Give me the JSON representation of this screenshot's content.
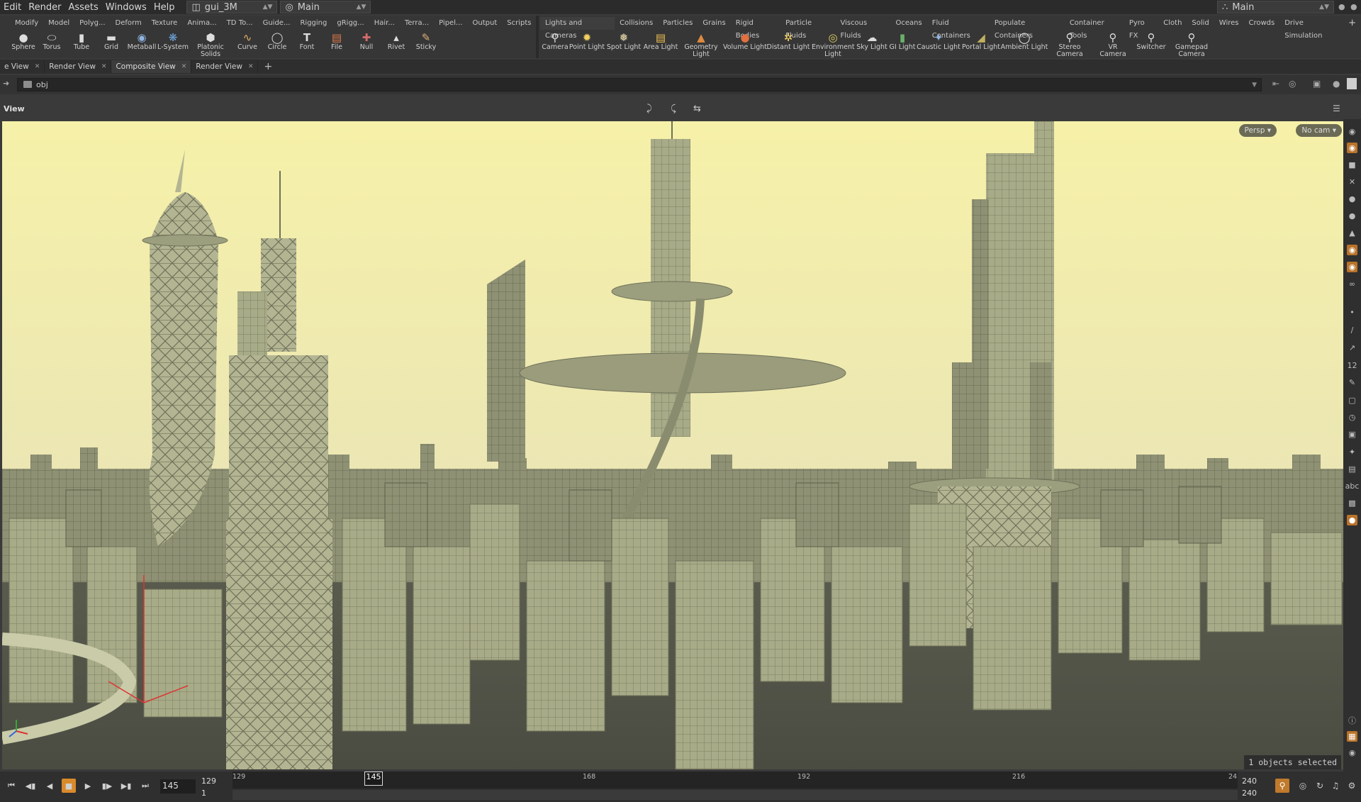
{
  "menu": {
    "items": [
      "Edit",
      "Render",
      "Assets",
      "Windows",
      "Help"
    ]
  },
  "desktop": {
    "selector": "gui_3M",
    "context": "Main"
  },
  "right_desktop": "Main",
  "shelf_left": {
    "tabs": [
      "Modify",
      "Model",
      "Polyg...",
      "Deform",
      "Texture",
      "Anima...",
      "TD To...",
      "Guide...",
      "Rigging",
      "gRigg...",
      "Hair...",
      "Terra...",
      "Pipel...",
      "Output",
      "Scripts"
    ],
    "tools": [
      {
        "label": "Sphere",
        "icon": "sphere-icon"
      },
      {
        "label": "Torus",
        "icon": "torus-icon"
      },
      {
        "label": "Tube",
        "icon": "tube-icon"
      },
      {
        "label": "Grid",
        "icon": "grid-icon"
      },
      {
        "label": "Metaball",
        "icon": "metaball-icon"
      },
      {
        "label": "L-System",
        "icon": "lsystem-icon"
      },
      {
        "label": "Platonic Solids",
        "icon": "platonic-icon"
      },
      {
        "label": "Curve",
        "icon": "curve-icon"
      },
      {
        "label": "Circle",
        "icon": "circle-icon"
      },
      {
        "label": "Font",
        "icon": "font-icon"
      },
      {
        "label": "File",
        "icon": "file-icon"
      },
      {
        "label": "Null",
        "icon": "null-icon"
      },
      {
        "label": "Rivet",
        "icon": "rivet-icon"
      },
      {
        "label": "Sticky",
        "icon": "sticky-icon"
      }
    ]
  },
  "shelf_right": {
    "tabs": [
      "Lights and Cameras",
      "Collisions",
      "Particles",
      "Grains",
      "Rigid Bodies",
      "Particle Fluids",
      "Viscous Fluids",
      "Oceans",
      "Fluid Containers",
      "Populate Containers",
      "Container Tools",
      "Pyro FX",
      "Cloth",
      "Solid",
      "Wires",
      "Crowds",
      "Drive Simulation"
    ],
    "tools": [
      {
        "label": "Camera",
        "icon": "camera-icon"
      },
      {
        "label": "Point Light",
        "icon": "point-light-icon"
      },
      {
        "label": "Spot Light",
        "icon": "spot-light-icon"
      },
      {
        "label": "Area Light",
        "icon": "area-light-icon"
      },
      {
        "label": "Geometry Light",
        "icon": "geometry-light-icon"
      },
      {
        "label": "Volume Light",
        "icon": "volume-light-icon"
      },
      {
        "label": "Distant Light",
        "icon": "distant-light-icon"
      },
      {
        "label": "Environment Light",
        "icon": "environment-light-icon"
      },
      {
        "label": "Sky Light",
        "icon": "sky-light-icon"
      },
      {
        "label": "GI Light",
        "icon": "gi-light-icon"
      },
      {
        "label": "Caustic Light",
        "icon": "caustic-light-icon"
      },
      {
        "label": "Portal Light",
        "icon": "portal-light-icon"
      },
      {
        "label": "Ambient Light",
        "icon": "ambient-light-icon"
      },
      {
        "label": "Stereo Camera",
        "icon": "stereo-camera-icon"
      },
      {
        "label": "VR Camera",
        "icon": "vr-camera-icon"
      },
      {
        "label": "Switcher",
        "icon": "switcher-icon"
      },
      {
        "label": "Gamepad Camera",
        "icon": "gamepad-camera-icon"
      }
    ]
  },
  "pane_tabs": [
    {
      "label": "e View",
      "active": false
    },
    {
      "label": "Render View",
      "active": false
    },
    {
      "label": "Composite View",
      "active": true
    },
    {
      "label": "Render View",
      "active": false
    }
  ],
  "path": "obj",
  "viewer": {
    "title": "View",
    "persp": "Persp ▾",
    "cam": "No cam ▾",
    "status": "1 objects selected"
  },
  "timeline": {
    "current_frame": "145",
    "start": "129",
    "sub_start": "1",
    "end": "240",
    "sub_end": "240",
    "ticks": [
      "129",
      "168",
      "192",
      "216",
      "24"
    ],
    "cursor_label": "145"
  },
  "colors": {
    "accent": "#d98a2a",
    "sky_top": "#f6f1a8",
    "building": "#a8ab87"
  }
}
